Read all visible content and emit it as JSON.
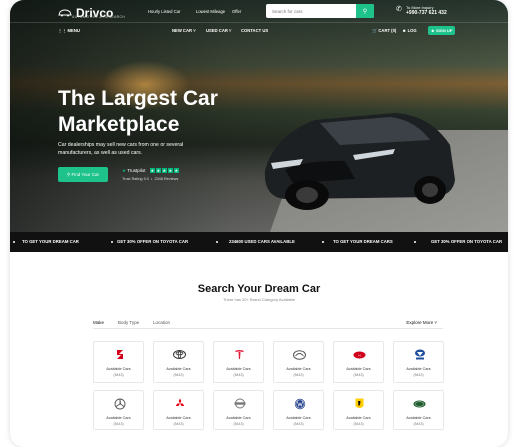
{
  "header": {
    "logo_name": "Drivco",
    "logo_tagline": "AUTOMOTIVE & RESEARCH",
    "top_links": [
      "Hourly Listed Car",
      "Lowest Mileage",
      "Offer"
    ],
    "search_placeholder": "Search for cars",
    "phone_label": "To More Inquiry",
    "phone_number": "+990-737 621 432"
  },
  "nav": {
    "menu_label": "MENU",
    "items": [
      "NEW CAR",
      "USED CAR",
      "CONTACT US"
    ],
    "cart_label": "CART (0)",
    "login_label": "LOG",
    "signup_label": "SIGN UP"
  },
  "hero": {
    "title_line1": "The Largest Car",
    "title_line2": "Marketplace",
    "subtitle": "Car dealerships may sell new cars from one or several manufacturers, as well as used cars.",
    "cta_label": "Find Your Car",
    "trustpilot_label": "Trustpilot",
    "trustpilot_rating": "Trust Rating 5.0",
    "trustpilot_reviews": "2348 Reviews"
  },
  "ticker": {
    "items": [
      "TO GET YOUR DREAM CAR",
      "GET 30% OFFER ON TOYOTA CAR",
      "234600 USED CARS AVAILABLE",
      "TO GET YOUR DREAM CARS",
      "GET 30% OFFER ON TOYOTA CAR"
    ]
  },
  "search_section": {
    "title": "Search Your Dream Car",
    "subtitle": "There has 20+ Brand Category Available",
    "tabs": [
      "Make",
      "Body Type",
      "Location"
    ],
    "explore_label": "Explore More"
  },
  "brands": [
    {
      "icon": "suzuki-logo-icon",
      "label": "Available Cars",
      "count": "(5443)"
    },
    {
      "icon": "toyota-logo-icon",
      "label": "Available Cars",
      "count": "(5443)"
    },
    {
      "icon": "tesla-logo-icon",
      "label": "Available Cars",
      "count": "(5443)"
    },
    {
      "icon": "mazda-logo-icon",
      "label": "Available Cars",
      "count": "(5443)"
    },
    {
      "icon": "honda-logo-icon",
      "label": "Available Cars",
      "count": "(5443)"
    },
    {
      "icon": "tata-logo-icon",
      "label": "Available Cars",
      "count": "(5443)"
    },
    {
      "icon": "mercedes-logo-icon",
      "label": "Available Cars",
      "count": "(5443)"
    },
    {
      "icon": "mitsubishi-logo-icon",
      "label": "Available Cars",
      "count": "(5443)"
    },
    {
      "icon": "nissan-logo-icon",
      "label": "Available Cars",
      "count": "(5443)"
    },
    {
      "icon": "volkswagen-logo-icon",
      "label": "Available Cars",
      "count": "(5443)"
    },
    {
      "icon": "ferrari-logo-icon",
      "label": "Available Cars",
      "count": "(5443)"
    },
    {
      "icon": "landrover-logo-icon",
      "label": "Available Cars",
      "count": "(5443)"
    }
  ],
  "colors": {
    "accent": "#1ec28b",
    "dark": "#111111",
    "trustpilot": "#00b67a"
  }
}
